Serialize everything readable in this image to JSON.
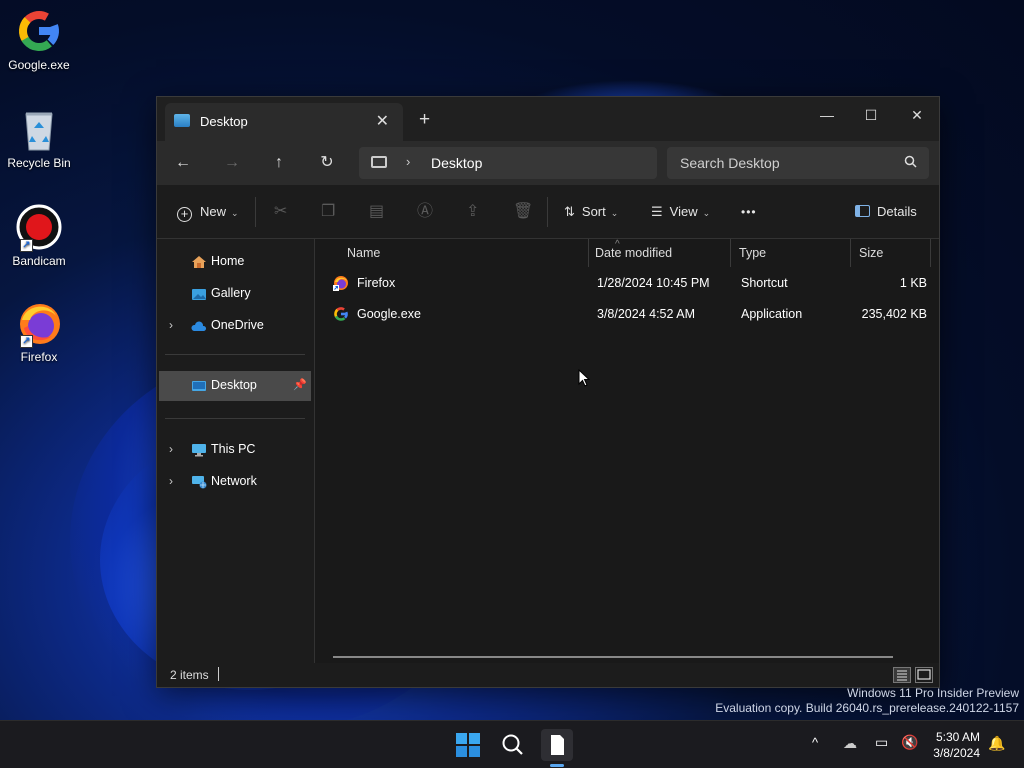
{
  "desktop": {
    "icons": [
      {
        "label": "Google.exe",
        "icon": "google-icon"
      },
      {
        "label": "Recycle Bin",
        "icon": "recycle-bin-icon"
      },
      {
        "label": "Bandicam",
        "icon": "bandicam-icon"
      },
      {
        "label": "Firefox",
        "icon": "firefox-icon"
      }
    ]
  },
  "window": {
    "tab_title": "Desktop",
    "tab_close": "✕",
    "new_tab": "+",
    "minimize": "—",
    "maximize": "☐",
    "close": "✕",
    "nav": {
      "back": "←",
      "forward": "→",
      "up": "↑",
      "refresh": "↻"
    },
    "address": {
      "crumb": "Desktop",
      "separator": "›"
    },
    "search": {
      "placeholder": "Search Desktop"
    },
    "toolbar": {
      "new_label": "New",
      "sort_label": "Sort",
      "view_label": "View",
      "more": "•••",
      "details_label": "Details"
    },
    "navpane": {
      "items": [
        {
          "label": "Home",
          "icon": "home-icon"
        },
        {
          "label": "Gallery",
          "icon": "gallery-icon"
        },
        {
          "label": "OneDrive",
          "icon": "onedrive-icon"
        },
        {
          "label": "Desktop",
          "icon": "desktop-icon"
        },
        {
          "label": "This PC",
          "icon": "this-pc-icon"
        },
        {
          "label": "Network",
          "icon": "network-icon"
        }
      ]
    },
    "columns": {
      "name": "Name",
      "date": "Date modified",
      "type": "Type",
      "size": "Size"
    },
    "files": [
      {
        "name": "Firefox",
        "date": "1/28/2024 10:45 PM",
        "type": "Shortcut",
        "size": "1 KB"
      },
      {
        "name": "Google.exe",
        "date": "3/8/2024 4:52 AM",
        "type": "Application",
        "size": "235,402 KB"
      }
    ],
    "status": {
      "items": "2 items"
    }
  },
  "watermark": {
    "line1": "Windows 11 Pro Insider Preview",
    "line2": "Evaluation copy. Build 26040.rs_prerelease.240122-1157"
  },
  "taskbar": {
    "time": "5:30 AM",
    "date": "3/8/2024"
  },
  "colors": {
    "accent": "#1a66d4",
    "window_bg": "#1c1c1c",
    "selected": "#4a4a4a"
  }
}
